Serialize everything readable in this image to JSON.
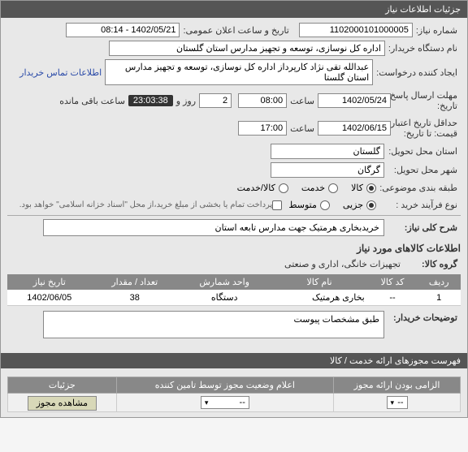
{
  "header": {
    "title": "جزئیات اطلاعات نیاز"
  },
  "rows": {
    "request_no_label": "شماره نیاز:",
    "request_no": "1102000101000005",
    "public_datetime_label": "تاریخ و ساعت اعلان عمومی:",
    "public_datetime": "1402/05/21 - 08:14",
    "buyer_org_label": "نام دستگاه خریدار:",
    "buyer_org": "اداره کل نوسازی، توسعه و تجهیز مدارس استان گلستان",
    "creator_label": "ایجاد کننده درخواست:",
    "creator": "عبدالله تقی نژاد کارپرداز اداره کل نوسازی، توسعه و تجهیز مدارس استان گلستا",
    "contact_link": "اطلاعات تماس خریدار",
    "response_deadline_label": "مهلت ارسال پاسخ:",
    "response_date_label": "تاریخ:",
    "response_date": "1402/05/24",
    "response_time_label": "ساعت",
    "response_time": "08:00",
    "days_label": "روز و",
    "days_value": "2",
    "remaining_label": "ساعت باقی مانده",
    "remaining_time": "23:03:38",
    "min_valid_label": "حداقل تاریخ اعتبار",
    "quote_until_label": "قیمت: تا تاریخ:",
    "quote_date": "1402/06/15",
    "quote_time": "17:00",
    "province_label": "استان محل تحویل:",
    "province": "گلستان",
    "city_label": "شهر محل تحویل:",
    "city": "گرگان",
    "category_label": "طبقه بندی موضوعی:",
    "cat_goods": "کالا",
    "cat_service": "خدمت",
    "cat_both": "کالا/خدمت",
    "process_label": "نوع فرآیند خرید :",
    "process_partial": "جزیی",
    "process_medium": "متوسط",
    "process_note": "پرداخت تمام یا بخشی از مبلغ خرید،از محل \"اسناد خزانه اسلامی\" خواهد بود.",
    "summary_label": "شرح کلی نیاز:",
    "summary_text": "خریدبخاری هرمتیک جهت مدارس تابعه استان",
    "goods_info_title": "اطلاعات کالاهای مورد نیاز",
    "goods_group_label": "گروه کالا:",
    "goods_group_value": "تجهیزات خانگی، اداری و صنعتی",
    "table": {
      "headers": {
        "row": "ردیف",
        "code": "کد کالا",
        "name": "نام کالا",
        "unit": "واحد شمارش",
        "qty": "تعداد / مقدار",
        "date": "تاریخ نیاز"
      },
      "rows": [
        {
          "row": "1",
          "code": "--",
          "name": "بخاری هرمتیک",
          "unit": "دستگاه",
          "qty": "38",
          "date": "1402/06/05"
        }
      ]
    },
    "buyer_notes_label": "توضیحات خریدار:",
    "buyer_notes_text": "طبق مشخصات پیوست"
  },
  "permits": {
    "section_title": "فهرست مجوزهای ارائه خدمت / کالا",
    "headers": {
      "required": "الزامی بودن ارائه مجوز",
      "status": "اعلام وضعیت مجوز توسط تامین کننده",
      "details": "جزئیات"
    },
    "row": {
      "required_placeholder": "--",
      "status_placeholder": "--",
      "btn": "مشاهده مجوز"
    }
  }
}
